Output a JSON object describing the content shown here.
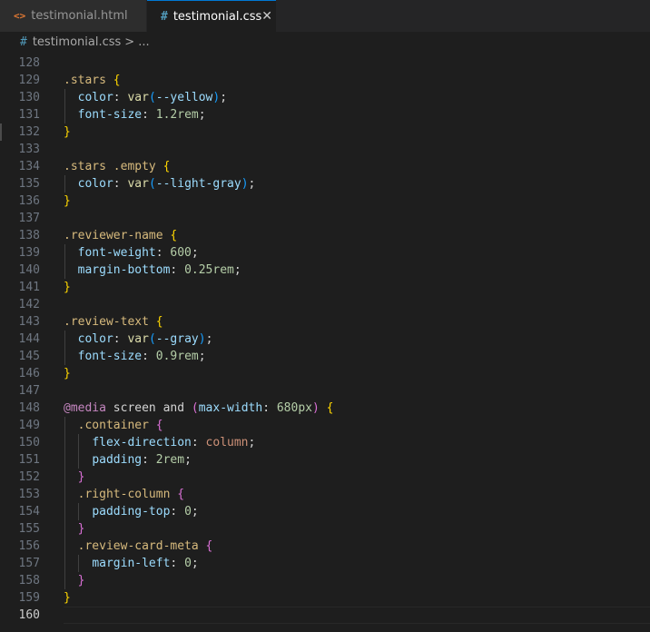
{
  "tabs": [
    {
      "label": "testimonial.html",
      "icon": "html-file-icon",
      "active": false
    },
    {
      "label": "testimonial.css",
      "icon": "css-file-icon",
      "active": true
    }
  ],
  "breadcrumb": {
    "file": "testimonial.css",
    "separator": ">",
    "ellipsis": "..."
  },
  "editor": {
    "current_line": 160,
    "lines": [
      {
        "n": "128",
        "t": ""
      },
      {
        "n": "129",
        "t": ".stars {"
      },
      {
        "n": "130",
        "t": "  color: var(--yellow);"
      },
      {
        "n": "131",
        "t": "  font-size: 1.2rem;"
      },
      {
        "n": "132",
        "t": "}"
      },
      {
        "n": "133",
        "t": ""
      },
      {
        "n": "134",
        "t": ".stars .empty {"
      },
      {
        "n": "135",
        "t": "  color: var(--light-gray);"
      },
      {
        "n": "136",
        "t": "}"
      },
      {
        "n": "137",
        "t": ""
      },
      {
        "n": "138",
        "t": ".reviewer-name {"
      },
      {
        "n": "139",
        "t": "  font-weight: 600;"
      },
      {
        "n": "140",
        "t": "  margin-bottom: 0.25rem;"
      },
      {
        "n": "141",
        "t": "}"
      },
      {
        "n": "142",
        "t": ""
      },
      {
        "n": "143",
        "t": ".review-text {"
      },
      {
        "n": "144",
        "t": "  color: var(--gray);"
      },
      {
        "n": "145",
        "t": "  font-size: 0.9rem;"
      },
      {
        "n": "146",
        "t": "}"
      },
      {
        "n": "147",
        "t": ""
      },
      {
        "n": "148",
        "t": "@media screen and (max-width: 680px) {"
      },
      {
        "n": "149",
        "t": "  .container {"
      },
      {
        "n": "150",
        "t": "    flex-direction: column;"
      },
      {
        "n": "151",
        "t": "    padding: 2rem;"
      },
      {
        "n": "152",
        "t": "  }"
      },
      {
        "n": "153",
        "t": "  .right-column {"
      },
      {
        "n": "154",
        "t": "    padding-top: 0;"
      },
      {
        "n": "155",
        "t": "  }"
      },
      {
        "n": "156",
        "t": "  .review-card-meta {"
      },
      {
        "n": "157",
        "t": "    margin-left: 0;"
      },
      {
        "n": "158",
        "t": "  }"
      },
      {
        "n": "159",
        "t": "}"
      },
      {
        "n": "160",
        "t": ""
      }
    ]
  },
  "colors": {
    "editor_bg": "#1e1e1e",
    "tab_active_border": "#0078d4",
    "selector": "#d7ba7d",
    "property": "#9cdcfe",
    "number": "#b5cea8",
    "at_rule": "#c586c0"
  }
}
